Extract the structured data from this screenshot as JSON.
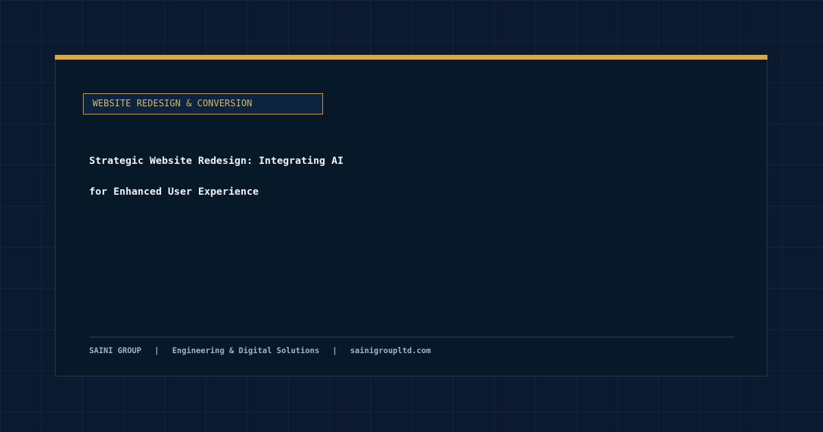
{
  "colors": {
    "background": "#0b1a2e",
    "card": "#071829",
    "accent": "#d4a94a",
    "tag_border": "#c9a44e",
    "headline": "#f2f4f7",
    "footer_text": "#9fb2c8"
  },
  "tag": {
    "label": "WEBSITE REDESIGN & CONVERSION"
  },
  "headline": {
    "line1": "Strategic Website Redesign: Integrating AI",
    "line2": "for Enhanced User Experience"
  },
  "footer": {
    "company": "SAINI GROUP",
    "separator": "|",
    "tagline": "Engineering & Digital Solutions",
    "website": "sainigroupltd.com"
  }
}
